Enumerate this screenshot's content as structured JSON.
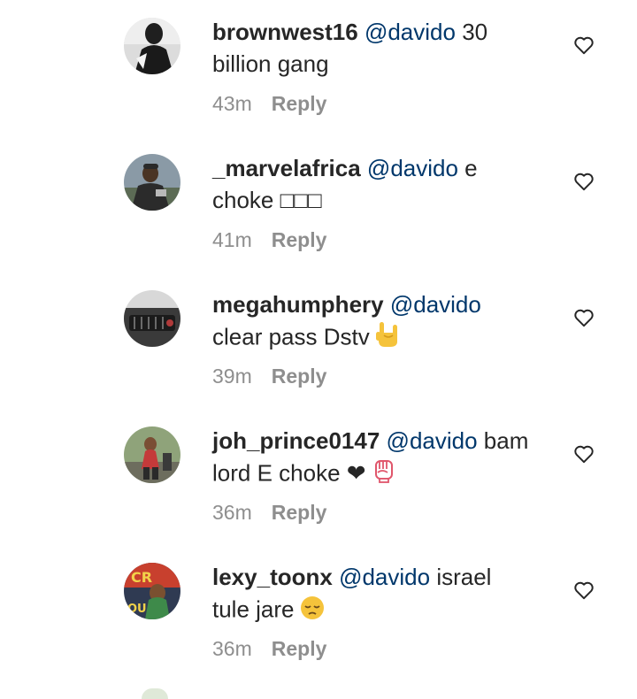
{
  "comments": [
    {
      "username": "brownwest16",
      "mention": "@davido",
      "text_line1": "30",
      "text_line2": "billion gang",
      "emoji": "",
      "time": "43m",
      "reply": "Reply",
      "icons": {
        "avatar": "avatar",
        "like": "heart-outline-icon"
      }
    },
    {
      "username": "_marvelafrica",
      "mention": "@davido",
      "text_line1": "e",
      "text_line2": "choke □□□",
      "emoji": "",
      "time": "41m",
      "reply": "Reply",
      "icons": {
        "avatar": "avatar",
        "like": "heart-outline-icon"
      }
    },
    {
      "username": "megahumphery",
      "mention": "@davido",
      "text_line1": "",
      "text_line2": "clear pass Dstv",
      "emoji": "love-you-gesture-emoji",
      "time": "39m",
      "reply": "Reply",
      "icons": {
        "avatar": "avatar",
        "like": "heart-outline-icon"
      }
    },
    {
      "username": "joh_prince0147",
      "mention": "@davido",
      "text_line1": "bam",
      "text_line2": "lord E choke ❤",
      "emoji": "raised-fist-emoji",
      "time": "36m",
      "reply": "Reply",
      "icons": {
        "avatar": "avatar",
        "like": "heart-outline-icon"
      }
    },
    {
      "username": "lexy_toonx",
      "mention": "@davido",
      "text_line1": "israel",
      "text_line2": "tule jare",
      "emoji": "pensive-face-emoji",
      "time": "36m",
      "reply": "Reply",
      "icons": {
        "avatar": "avatar",
        "like": "heart-outline-icon"
      }
    }
  ],
  "colors": {
    "text": "#262626",
    "mention": "#00376b",
    "meta": "#8e8e8e",
    "background": "#ffffff"
  }
}
